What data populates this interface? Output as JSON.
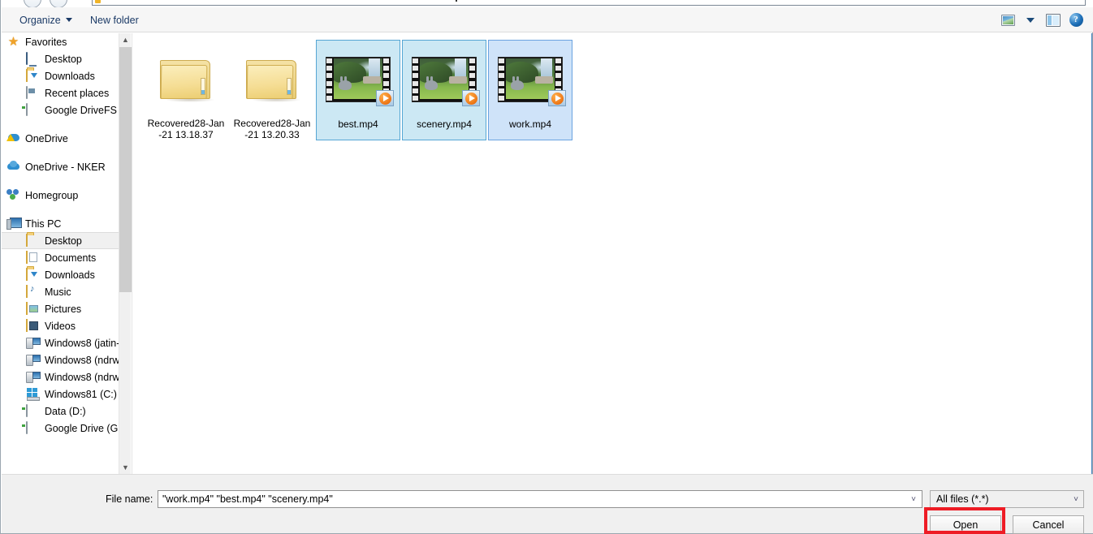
{
  "window": {
    "type": "file-open-dialog",
    "accent_selection": "#cce8f4",
    "accent_focus": "#cfe3f9",
    "highlight_color": "#ee1c25"
  },
  "toolbar": {
    "organize_label": "Organize",
    "new_folder_label": "New folder",
    "icons": [
      {
        "name": "view-mode-icon",
        "glyph": "picture"
      },
      {
        "name": "view-mode-dropdown-icon",
        "glyph": "chevron-down"
      },
      {
        "name": "preview-pane-icon",
        "glyph": "pane"
      },
      {
        "name": "help-icon",
        "glyph": "question",
        "label": "?"
      }
    ]
  },
  "sidebar": {
    "groups": [
      {
        "header": {
          "label": "Favorites",
          "icon": "star-icon"
        },
        "items": [
          {
            "label": "Desktop",
            "icon": "monitor-icon"
          },
          {
            "label": "Downloads",
            "icon": "downloads-folder-icon"
          },
          {
            "label": "Recent places",
            "icon": "recent-places-icon"
          },
          {
            "label": "Google DriveFS",
            "icon": "drive-icon"
          }
        ]
      },
      {
        "header": {
          "label": "OneDrive",
          "icon": "onedrive-warning-icon"
        },
        "items": []
      },
      {
        "header": {
          "label": "OneDrive - NKER",
          "icon": "onedrive-icon"
        },
        "items": []
      },
      {
        "header": {
          "label": "Homegroup",
          "icon": "homegroup-icon"
        },
        "items": []
      },
      {
        "header": {
          "label": "This PC",
          "icon": "this-pc-icon"
        },
        "items": [
          {
            "label": "Desktop",
            "icon": "desktop-folder-icon",
            "selected": true
          },
          {
            "label": "Documents",
            "icon": "documents-folder-icon"
          },
          {
            "label": "Downloads",
            "icon": "downloads-folder-icon"
          },
          {
            "label": "Music",
            "icon": "music-folder-icon"
          },
          {
            "label": "Pictures",
            "icon": "pictures-folder-icon"
          },
          {
            "label": "Videos",
            "icon": "videos-folder-icon"
          },
          {
            "label": "Windows8 (jatin-",
            "icon": "network-drive-icon"
          },
          {
            "label": "Windows8 (ndrw",
            "icon": "network-drive-icon"
          },
          {
            "label": "Windows8 (ndrw",
            "icon": "network-drive-icon"
          },
          {
            "label": "Windows81 (C:)",
            "icon": "windows-drive-icon"
          },
          {
            "label": "Data (D:)",
            "icon": "drive-icon"
          },
          {
            "label": "Google Drive (G:)",
            "icon": "drive-icon"
          }
        ]
      }
    ],
    "scrollbar": {
      "up_arrow": "▲",
      "down_arrow": "▼"
    }
  },
  "files": [
    {
      "name": "Recovered28-Jan\n-21 13.18.37",
      "type": "folder",
      "selected": false
    },
    {
      "name": "Recovered28-Jan\n-21 13.20.33",
      "type": "folder",
      "selected": false
    },
    {
      "name": "best.mp4",
      "type": "video",
      "selected": true,
      "focused": false
    },
    {
      "name": "scenery.mp4",
      "type": "video",
      "selected": true,
      "focused": false
    },
    {
      "name": "work.mp4",
      "type": "video",
      "selected": true,
      "focused": true
    }
  ],
  "bottom": {
    "file_name_label": "File name:",
    "file_name_value": "\"work.mp4\" \"best.mp4\" \"scenery.mp4\"",
    "file_name_placeholder": "File name",
    "file_type_value": "All files (*.*)",
    "open_label": "Open",
    "cancel_label": "Cancel",
    "dropdown_glyph": "⌄"
  }
}
